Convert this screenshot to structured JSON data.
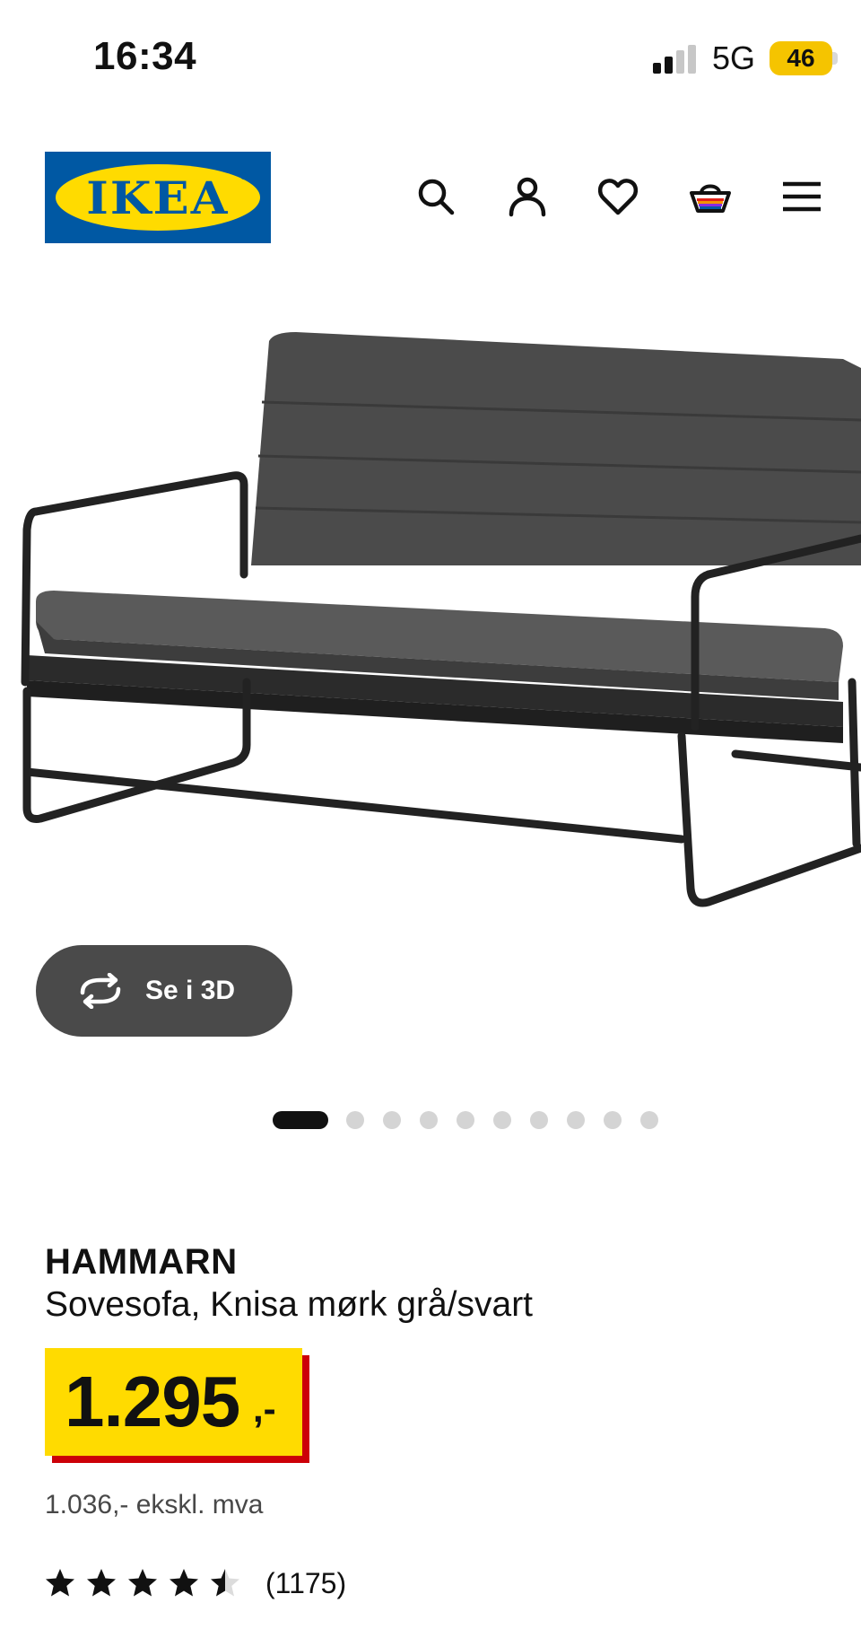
{
  "status_bar": {
    "time": "16:34",
    "network": "5G",
    "battery": "46"
  },
  "header": {
    "logo_text": "IKEA",
    "logo_mark": "®",
    "icons": [
      "search-icon",
      "account-icon",
      "favorites-heart-icon",
      "shopping-basket-icon",
      "hamburger-menu-icon"
    ]
  },
  "gallery": {
    "view_3d_label": "Se i 3D",
    "total_images": 10,
    "active_index": 0
  },
  "product": {
    "name": "HAMMARN",
    "description": "Sovesofa, Knisa mørk grå/svart",
    "price_main": "1.295",
    "price_suffix": ",-",
    "price_excl_vat": "1.036,- ekskl. mva",
    "rating_value": 4.5,
    "rating_max": 5,
    "review_count": "(1175)"
  },
  "colors": {
    "ikea_blue": "#0058a3",
    "ikea_yellow": "#ffdb00",
    "price_shadow_red": "#cc0008",
    "button_gray": "#4a4a4a"
  }
}
